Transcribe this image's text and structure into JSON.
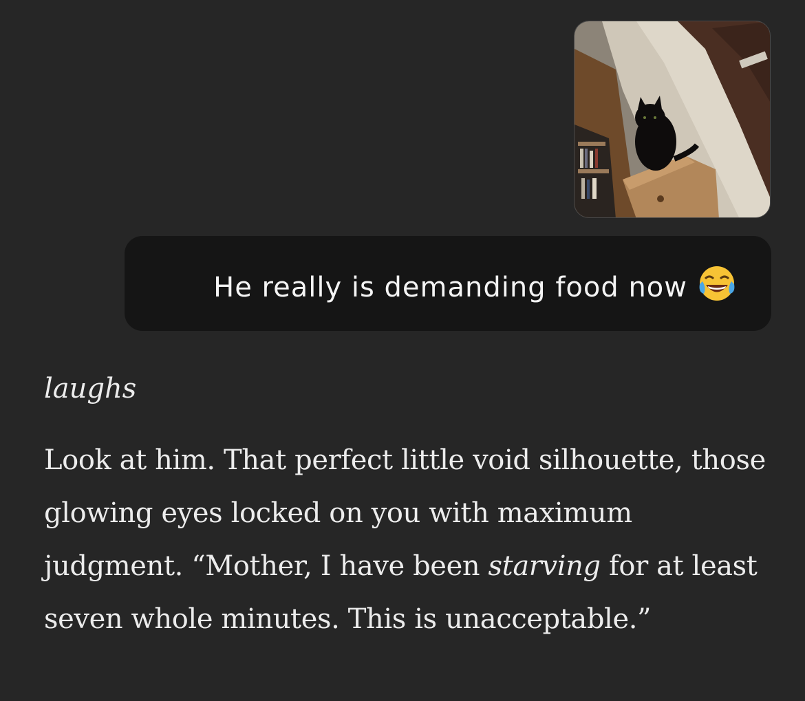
{
  "user_message": {
    "attachment_icon": "photo-thumbnail",
    "text": "He really is demanding food now",
    "emoji_icon": "face-with-tears-of-joy-icon"
  },
  "assistant_message": {
    "action": "laughs",
    "paragraph": {
      "part1": "Look at him. That perfect little void silhouette, those glowing eyes locked on you with maximum judgment. “Mother, I have been ",
      "emphasis": "starving",
      "part2": " for at least seven whole minutes. This is unacceptable.”"
    }
  },
  "colors": {
    "background": "#262626",
    "user_bubble": "#151515",
    "text": "#ececec"
  }
}
